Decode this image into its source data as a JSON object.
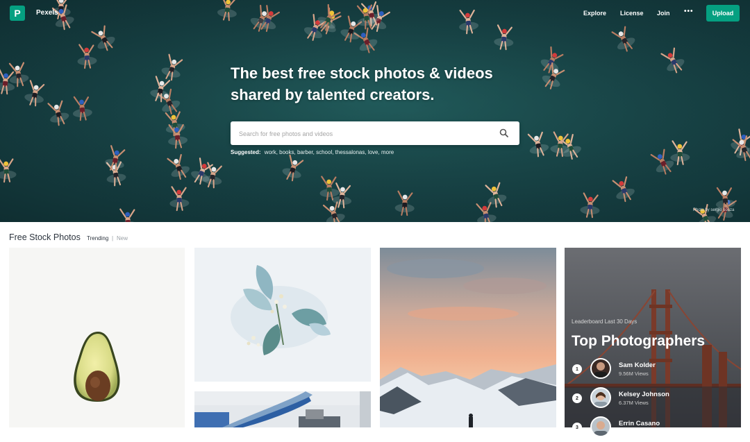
{
  "nav": {
    "brand": "Pexels",
    "links": [
      "Explore",
      "License",
      "Join"
    ],
    "more": "•••",
    "upload_label": "Upload"
  },
  "hero": {
    "headline_line1": "The best free stock photos & videos",
    "headline_line2": "shared by talented creators.",
    "search_placeholder": "Search for free photos and videos",
    "suggested_label": "Suggested:",
    "suggested_terms": [
      "work",
      "books",
      "barber",
      "school",
      "thessalonas",
      "love",
      "more"
    ],
    "photo_credit": "Photo by sergio souza"
  },
  "section": {
    "title": "Free Stock Photos",
    "tab_trending": "Trending",
    "tab_separator": "|",
    "tab_new": "New"
  },
  "leaderboard": {
    "subtitle": "Leaderboard Last 30 Days",
    "title": "Top Photographers",
    "entries": [
      {
        "rank": "1",
        "name": "Sam Kolder",
        "views": "9.56M Views"
      },
      {
        "rank": "2",
        "name": "Kelsey Johnson",
        "views": "6.37M Views"
      },
      {
        "rank": "3",
        "name": "Errin Casano",
        "views": ""
      }
    ]
  },
  "colors": {
    "accent": "#05a081",
    "hero_water": "#163f42",
    "text_dark": "#2c343e"
  }
}
